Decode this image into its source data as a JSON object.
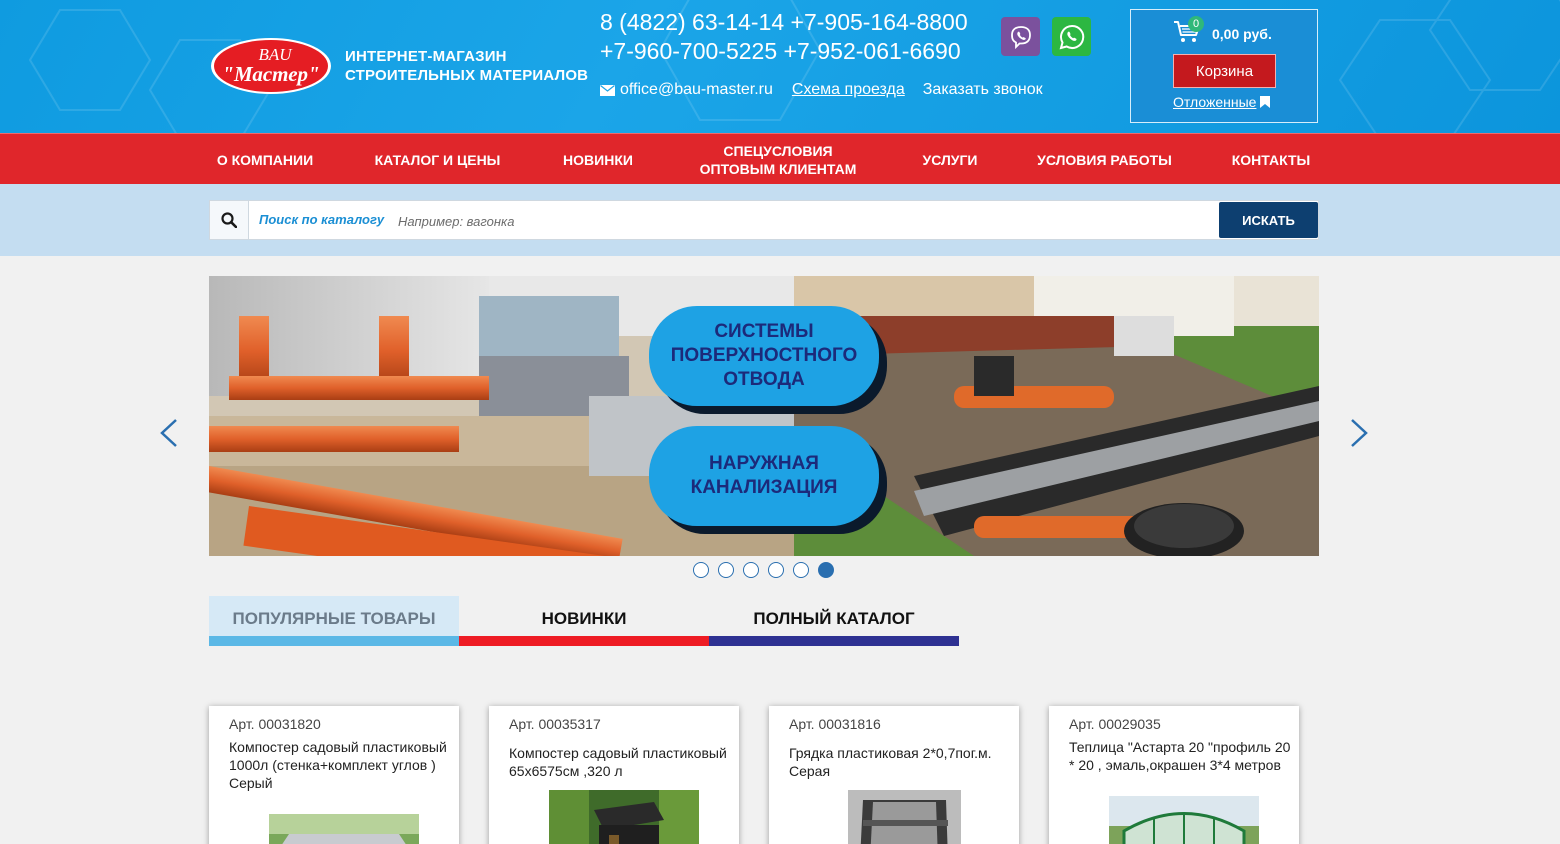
{
  "header": {
    "logo_text": [
      "ИНТЕРНЕТ-МАГАЗИН",
      "СТРОИТЕЛЬНЫХ МАТЕРИАЛОВ"
    ],
    "logo_wordmark_top": "BAU",
    "logo_wordmark_bottom": "\"Мастер\"",
    "phones": [
      "8 (4822) 63-14-14 +7-905-164-8800",
      "+7-960-700-5225 +7-952-061-6690"
    ],
    "email": "office@bau-master.ru",
    "route_link": "Схема проезда",
    "callback_link": "Заказать звонок",
    "messengers": [
      "viber-icon",
      "whatsapp-icon"
    ]
  },
  "cart": {
    "count": "0",
    "sum": "0,00 руб.",
    "button_label": "Корзина",
    "deferred_label": "Отложенные"
  },
  "nav": {
    "items": [
      "О КОМПАНИИ",
      "КАТАЛОГ И ЦЕНЫ",
      "НОВИНКИ",
      "СПЕЦУСЛОВИЯ\nОПТОВЫМ КЛИЕНТАМ",
      "УСЛУГИ",
      "УСЛОВИЯ РАБОТЫ",
      "КОНТАКТЫ"
    ]
  },
  "search": {
    "label": "Поиск по каталогу",
    "placeholder": "Например: вагонка",
    "button_label": "ИСКАТЬ"
  },
  "slider": {
    "labels": [
      "СИСТЕМЫ\nПОВЕРХНОСТНОГО\nОТВОДА",
      "НАРУЖНАЯ\nКАНАЛИЗАЦИЯ"
    ],
    "dot_count": 6,
    "active_dot": 6
  },
  "tabs": [
    {
      "label": "ПОПУЛЯРНЫЕ ТОВАРЫ",
      "color": "#5bb8e6",
      "active": true
    },
    {
      "label": "НОВИНКИ",
      "color": "#ee1c24",
      "active": false
    },
    {
      "label": "ПОЛНЫЙ КАТАЛОГ",
      "color": "#2e3192",
      "active": false
    }
  ],
  "products": [
    {
      "art": "Арт. 00031820",
      "title": "Компостер садовый пластиковый 1000л (стенка+комплект углов ) Серый"
    },
    {
      "art": "Арт. 00035317",
      "title": "Компостер садовый пластиковый 65х6575см ,320 л"
    },
    {
      "art": "Арт. 00031816",
      "title": "Грядка пластиковая 2*0,7пог.м. Серая"
    },
    {
      "art": "Арт. 00029035",
      "title": "Теплица \"Астарта 20 \"профиль 20 * 20 , эмаль,окрашен 3*4 метров"
    }
  ],
  "colors": {
    "header_blue": "#1ba5e8",
    "nav_red": "#e0262b",
    "search_band": "#c4ddf1",
    "search_button": "#0d3f70",
    "cart_button": "#c4191e"
  }
}
